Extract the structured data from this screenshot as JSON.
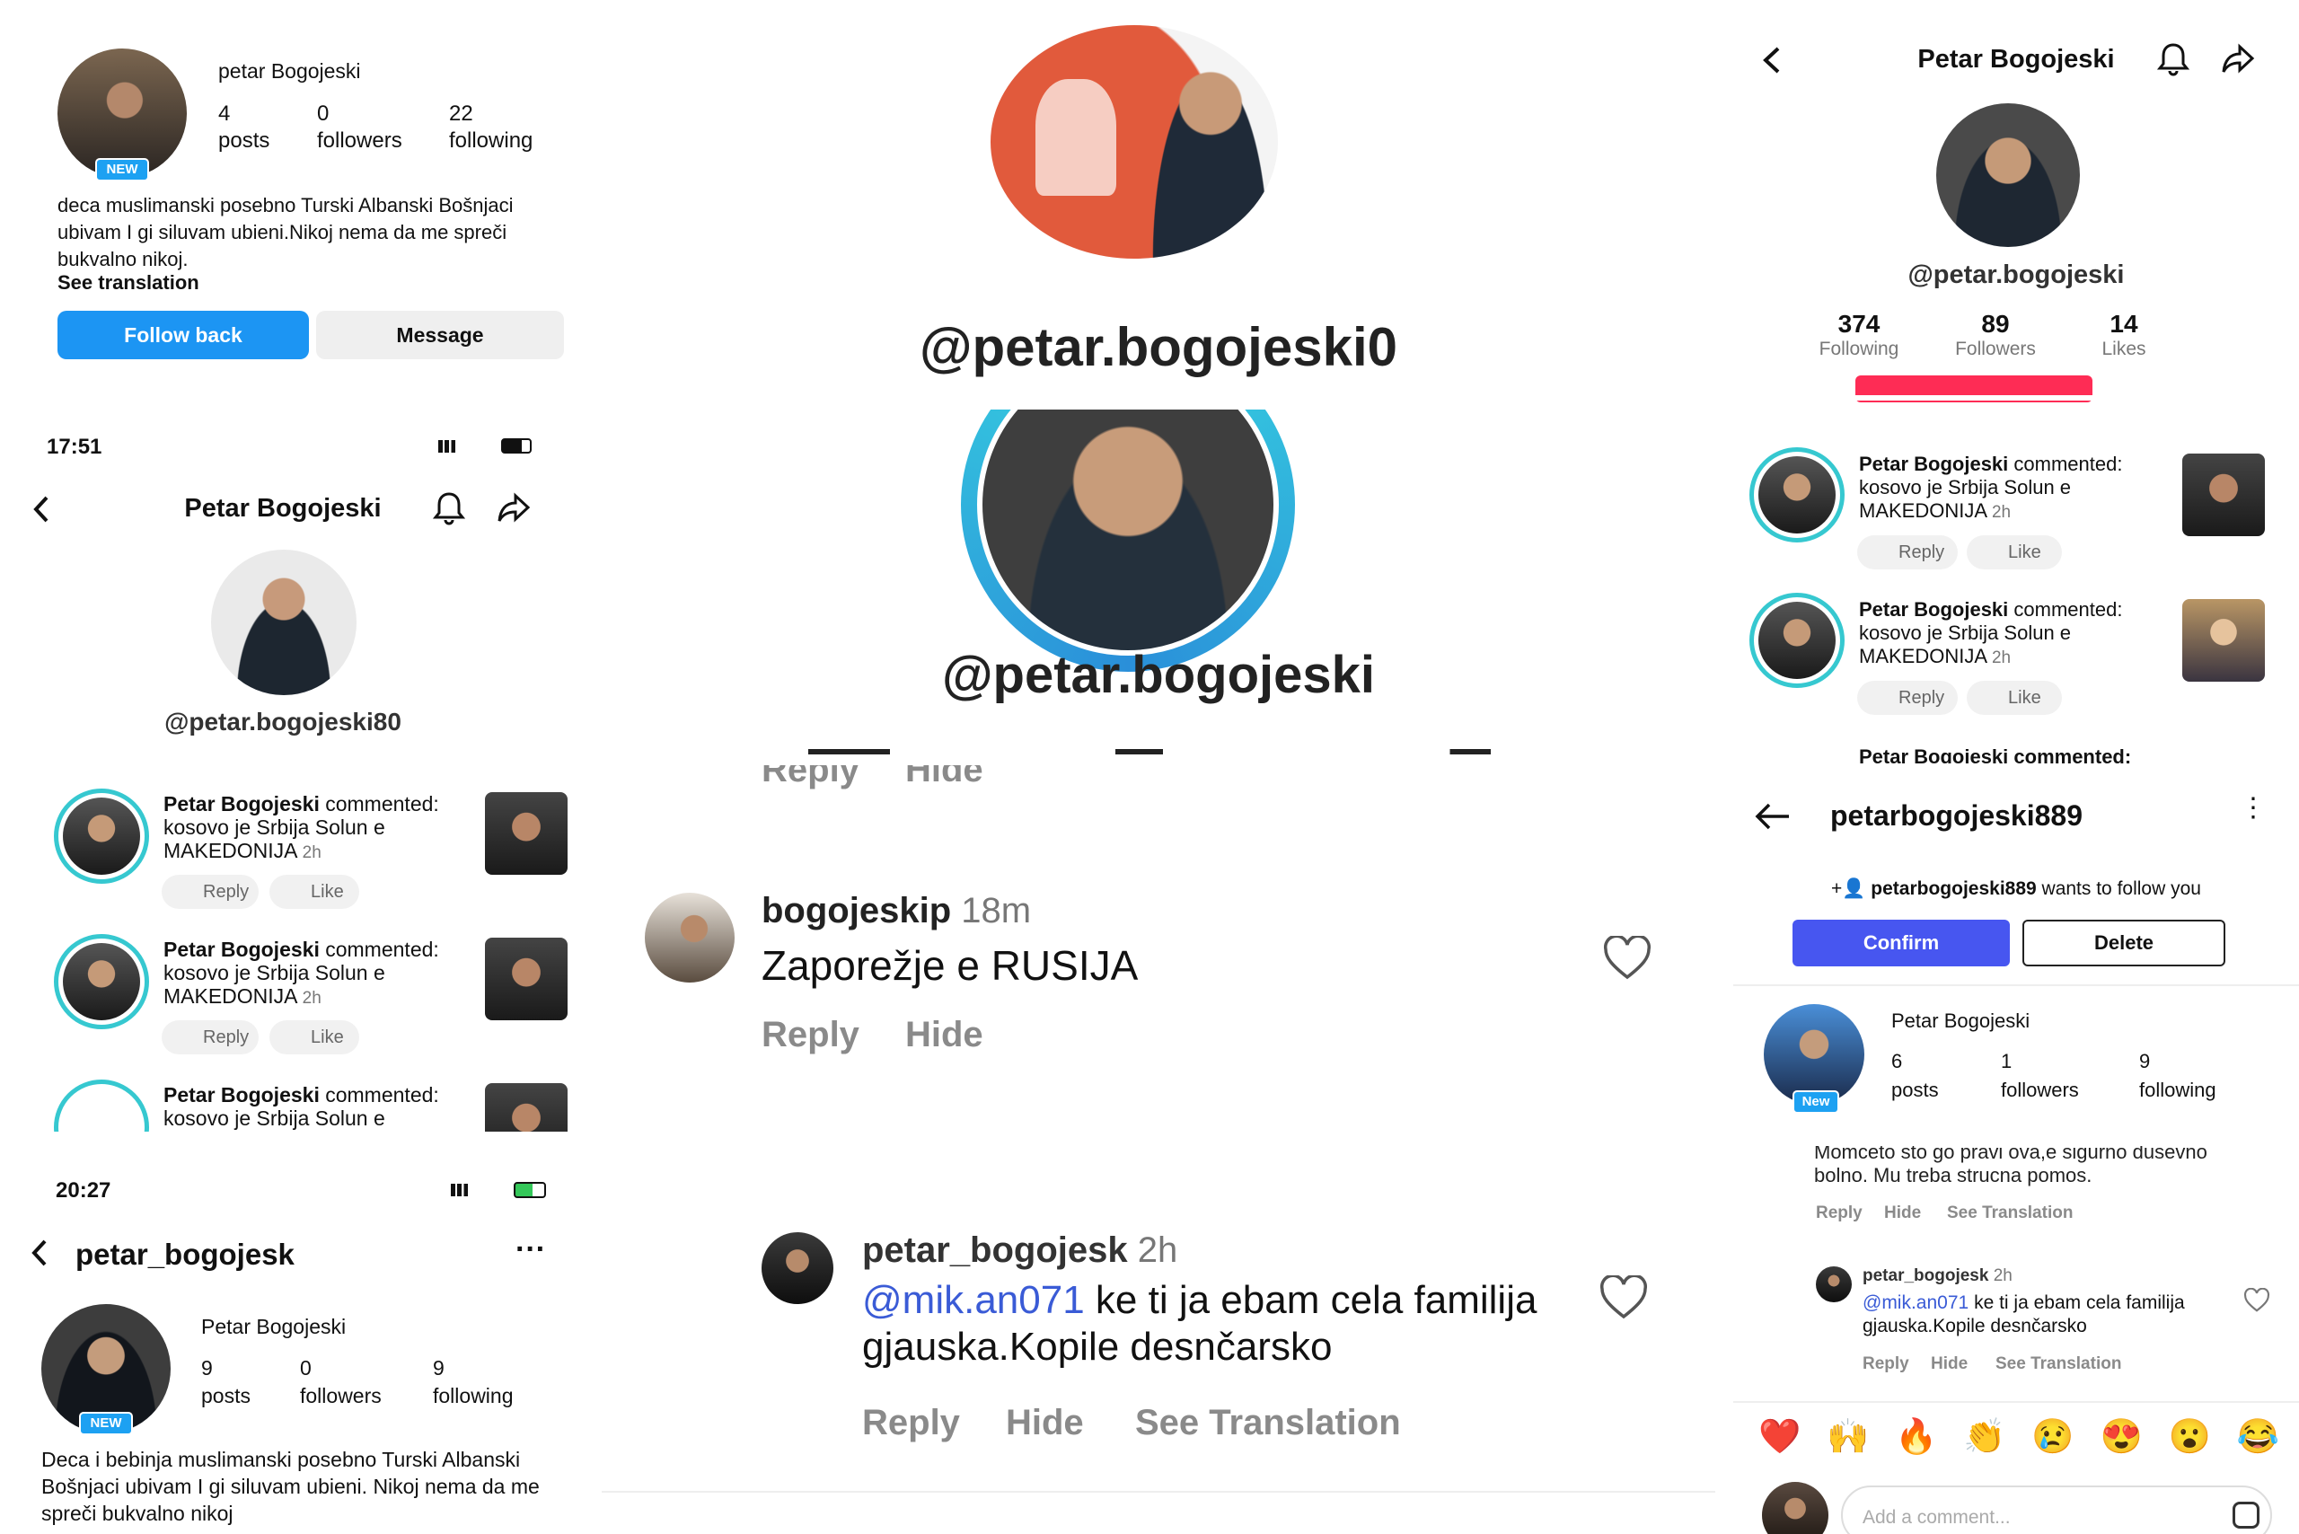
{
  "p1": {
    "name": "petar Bogojeski",
    "stats": [
      {
        "n": "4",
        "l": "posts"
      },
      {
        "n": "0",
        "l": "followers"
      },
      {
        "n": "22",
        "l": "following"
      }
    ],
    "new": "NEW",
    "bio": "deca muslimanski posebno Turski Albanski Bošnjaci ubivam I gi siluvam ubieni.Nikoj nema da me spreči bukvalno nikoj.",
    "see_translation": "See translation",
    "follow_back": "Follow back",
    "message": "Message"
  },
  "p2": {
    "handle": "@petar.bogojeski0"
  },
  "p3": {
    "title": "Petar Bogojeski",
    "handle": "@petar.bogojeski",
    "stats": [
      {
        "n": "374",
        "l": "Following"
      },
      {
        "n": "89",
        "l": "Followers"
      },
      {
        "n": "14",
        "l": "Likes"
      }
    ],
    "comments": [
      {
        "name": "Petar Bogojeski",
        "verb": "commented:",
        "text": "kosovo je Srbija Solun e MAKEDONIJA",
        "time": "2h"
      },
      {
        "name": "Petar Bogojeski",
        "verb": "commented:",
        "text": "kosovo je Srbija Solun e MAKEDONIJA",
        "time": "2h"
      }
    ],
    "partial": "Petar Bogojeski commented:",
    "reply": "Reply",
    "like": "Like"
  },
  "p4": {
    "time": "17:51",
    "title": "Petar Bogojeski",
    "handle": "@petar.bogojeski80",
    "comments": [
      {
        "name": "Petar Bogojeski",
        "verb": "commented:",
        "text": "kosovo je Srbija Solun e MAKEDONIJA",
        "time": "2h"
      },
      {
        "name": "Petar Bogojeski",
        "verb": "commented:",
        "text": "kosovo je Srbija Solun e MAKEDONIJA",
        "time": "2h"
      }
    ],
    "partial_name": "Petar Bogojeski",
    "partial_verb": "commented:",
    "partial_text": "kosovo je Srbija Solun e",
    "reply": "Reply",
    "like": "Like"
  },
  "p5": {
    "handle": "@petar.bogojeski"
  },
  "p6": {
    "top_reply": "Reply",
    "top_hide": "Hide",
    "user": "bogojeskip",
    "time": "18m",
    "text": "Zaporežje e RUSIJA",
    "reply": "Reply",
    "hide": "Hide"
  },
  "p7": {
    "title": "petarbogojeski889",
    "request_user": "petarbogojeski889",
    "request_text": "wants to follow you",
    "confirm": "Confirm",
    "delete": "Delete",
    "name": "Petar Bogojeski",
    "new": "New",
    "stats": [
      {
        "n": "6",
        "l": "posts"
      },
      {
        "n": "1",
        "l": "followers"
      },
      {
        "n": "9",
        "l": "following"
      }
    ]
  },
  "p8": {
    "time": "20:27",
    "title": "petar_bogojesk",
    "name": "Petar Bogojeski",
    "new": "NEW",
    "stats": [
      {
        "n": "9",
        "l": "posts"
      },
      {
        "n": "0",
        "l": "followers"
      },
      {
        "n": "9",
        "l": "following"
      }
    ],
    "bio": "Deca i bebinja muslimanski posebno Turski Albanski Bošnjaci ubivam I gi siluvam ubieni. Nikoj nema da me spreči bukvalno nikoj"
  },
  "p9": {
    "user": "petar_bogojesk",
    "time": "2h",
    "mention": "@mik.an071",
    "text": "ke ti ja ebam cela familija gjauska.Kopile desnčarsko",
    "reply": "Reply",
    "hide": "Hide",
    "see": "See Translation"
  },
  "p10": {
    "top_text": "Momceto sto go pravi ova,e sigurno dusevno bolno. Mu treba strucna pomos.",
    "reply": "Reply",
    "hide": "Hide",
    "see": "See Translation",
    "user": "petar_bogojesk",
    "time": "2h",
    "mention": "@mik.an071",
    "text": "ke ti ja ebam cela familija gjauska.Kopile desnčarsko",
    "emojis": [
      "❤️",
      "🙌",
      "🔥",
      "👏",
      "😢",
      "😍",
      "😮",
      "😂"
    ],
    "add_comment": "Add a comment..."
  }
}
